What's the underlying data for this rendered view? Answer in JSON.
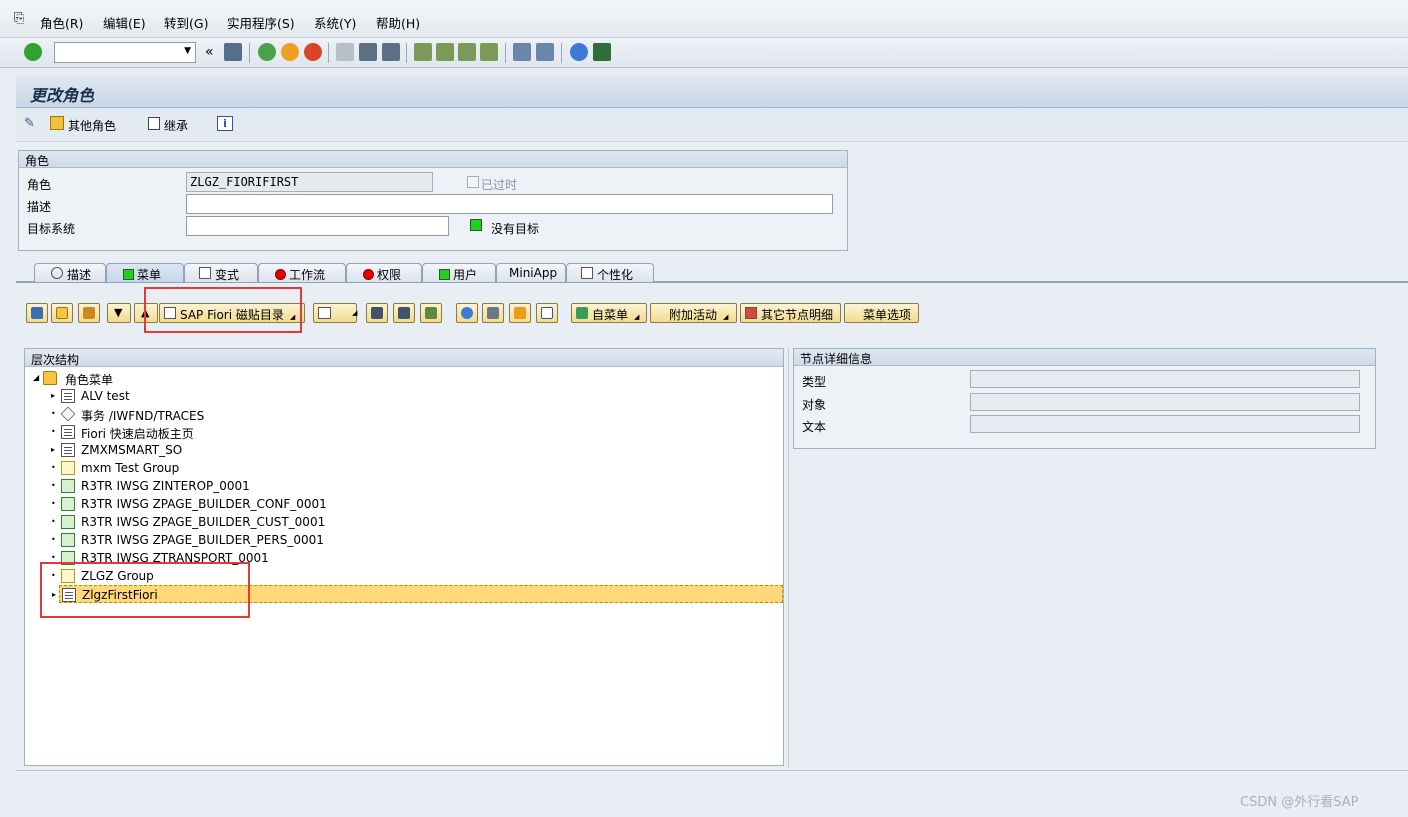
{
  "menubar": {
    "items": [
      "角色(R)",
      "编辑(E)",
      "转到(G)",
      "实用程序(S)",
      "系统(Y)",
      "帮助(H)"
    ]
  },
  "toolbar": {
    "command_field_value": "",
    "collapse_label": "«"
  },
  "title": "更改角色",
  "apptoolbar": {
    "other_roles": "其他角色",
    "inherit": "继承"
  },
  "role_group": {
    "header": "角色",
    "role_label": "角色",
    "role_value": "ZLGZ_FIORIFIRST",
    "obsolete_label": "已过时",
    "desc_label": "描述",
    "desc_value": "",
    "target_label": "目标系统",
    "target_value": "",
    "no_target_label": "没有目标"
  },
  "tabs": [
    "描述",
    "菜单",
    "变式",
    "工作流",
    "权限",
    "用户",
    "MiniApp",
    "个性化"
  ],
  "menu_toolbar": {
    "fiori_catalog": "SAP Fiori 磁贴目录",
    "self_menu": "自菜单",
    "add_activity": "附加活动",
    "other_node_details": "其它节点明细",
    "menu_options": "菜单选项"
  },
  "tree": {
    "header": "层次结构",
    "root": "角色菜单",
    "items": [
      {
        "label": "ALV test",
        "icon": "doc",
        "expandable": true
      },
      {
        "label": "事务 /IWFND/TRACES",
        "icon": "cube",
        "expandable": false
      },
      {
        "label": "Fiori 快速启动板主页",
        "icon": "doc",
        "expandable": false
      },
      {
        "label": "ZMXMSMART_SO",
        "icon": "doc",
        "expandable": true
      },
      {
        "label": "mxm Test Group",
        "icon": "grp",
        "expandable": false
      },
      {
        "label": "R3TR IWSG ZINTEROP_0001",
        "icon": "obj",
        "expandable": false
      },
      {
        "label": "R3TR IWSG ZPAGE_BUILDER_CONF_0001",
        "icon": "obj",
        "expandable": false
      },
      {
        "label": "R3TR IWSG ZPAGE_BUILDER_CUST_0001",
        "icon": "obj",
        "expandable": false
      },
      {
        "label": "R3TR IWSG ZPAGE_BUILDER_PERS_0001",
        "icon": "obj",
        "expandable": false
      },
      {
        "label": "R3TR IWSG ZTRANSPORT_0001",
        "icon": "obj",
        "expandable": false
      },
      {
        "label": "ZLGZ Group",
        "icon": "grp",
        "expandable": false
      },
      {
        "label": "ZlgzFirstFiori",
        "icon": "doc",
        "expandable": true,
        "selected": true
      }
    ]
  },
  "detail": {
    "header": "节点详细信息",
    "type_label": "类型",
    "object_label": "对象",
    "text_label": "文本"
  },
  "footer": "CSDN @外行看SAP"
}
